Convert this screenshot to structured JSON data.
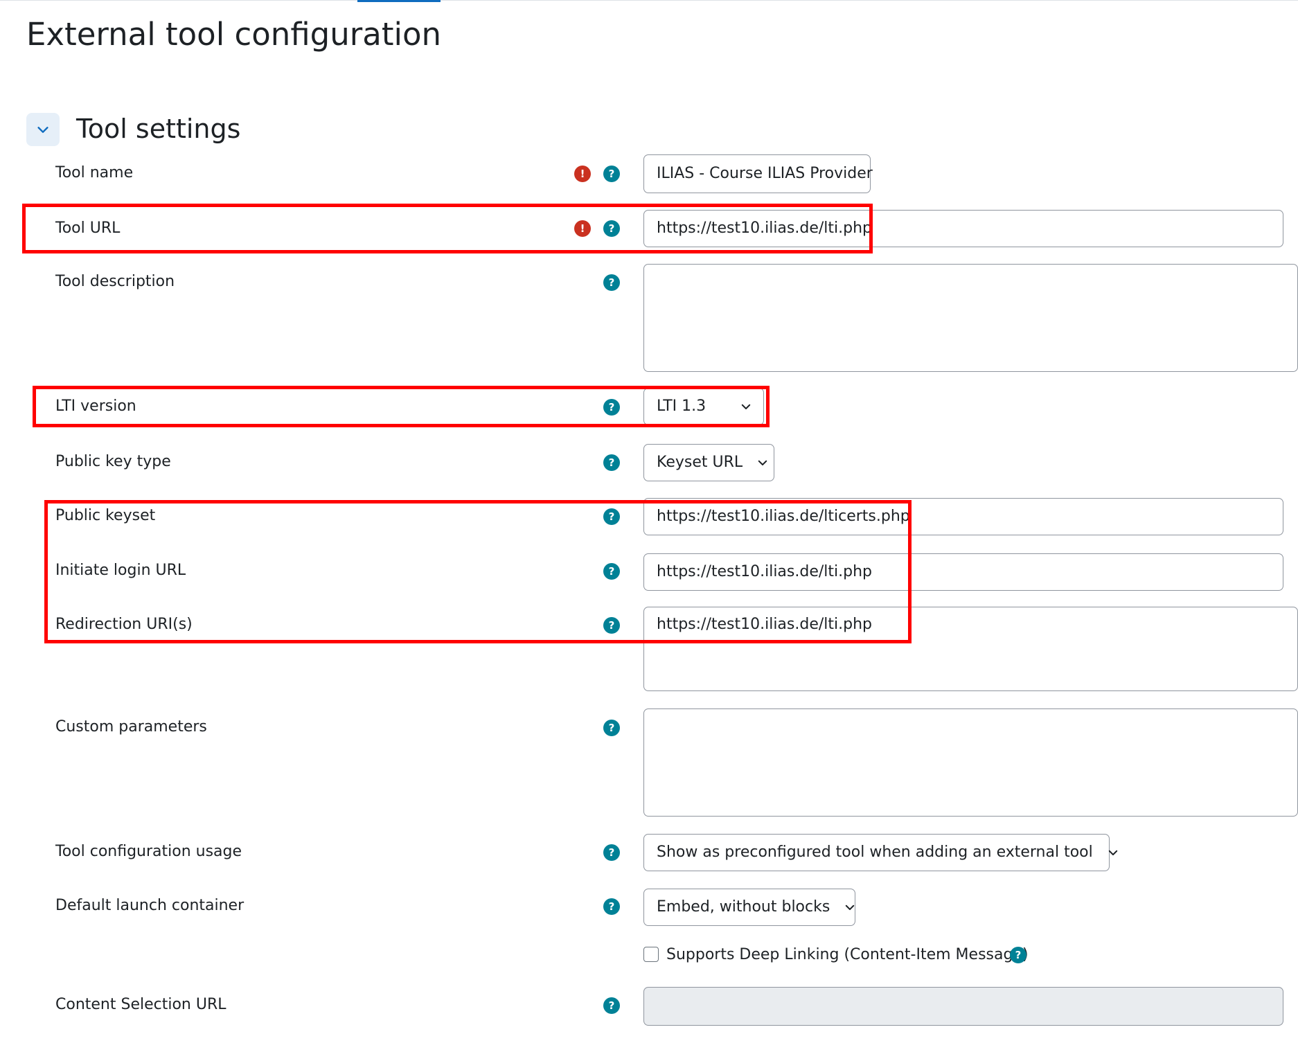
{
  "page": {
    "title": "External tool configuration"
  },
  "section": {
    "title": "Tool settings",
    "expanded": true
  },
  "fields": {
    "tool_name": {
      "label": "Tool name",
      "value": "ILIAS - Course ILIAS Provider",
      "required": true
    },
    "tool_url": {
      "label": "Tool URL",
      "value": "https://test10.ilias.de/lti.php",
      "required": true
    },
    "tool_description": {
      "label": "Tool description",
      "value": ""
    },
    "lti_version": {
      "label": "LTI version",
      "value": "LTI 1.3"
    },
    "public_key_type": {
      "label": "Public key type",
      "value": "Keyset URL"
    },
    "public_keyset": {
      "label": "Public keyset",
      "value": "https://test10.ilias.de/lticerts.php"
    },
    "initiate_login_url": {
      "label": "Initiate login URL",
      "value": "https://test10.ilias.de/lti.php"
    },
    "redirection_uris": {
      "label": "Redirection URI(s)",
      "value": "https://test10.ilias.de/lti.php"
    },
    "custom_parameters": {
      "label": "Custom parameters",
      "value": ""
    },
    "tool_configuration_usage": {
      "label": "Tool configuration usage",
      "value": "Show as preconfigured tool when adding an external tool"
    },
    "default_launch_container": {
      "label": "Default launch container",
      "value": "Embed, without blocks"
    },
    "supports_deep_linking": {
      "label": "Supports Deep Linking (Content-Item Message)",
      "checked": false
    },
    "content_selection_url": {
      "label": "Content Selection URL",
      "value": "",
      "disabled": true
    }
  },
  "icons": {
    "help": "question-circle-icon",
    "required": "exclamation-circle-icon",
    "toggle": "chevron-down-icon"
  },
  "colors": {
    "help_icon": "#008196",
    "required_icon": "#ca3120",
    "highlight": "#ff0000",
    "accent": "#0f6cbf"
  }
}
